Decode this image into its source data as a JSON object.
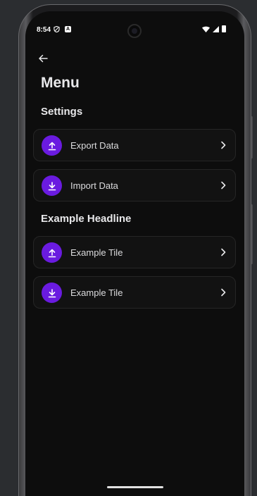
{
  "status_bar": {
    "time": "8:54",
    "icons": [
      "shield-icon",
      "a-icon",
      "wifi-icon",
      "signal-icon",
      "battery-icon"
    ]
  },
  "header": {
    "back_icon": "arrow-left-icon",
    "title": "Menu"
  },
  "sections": [
    {
      "title": "Settings",
      "tiles": [
        {
          "label": "Export Data",
          "icon": "upload-icon"
        },
        {
          "label": "Import Data",
          "icon": "download-icon"
        }
      ]
    },
    {
      "title": "Example Headline",
      "tiles": [
        {
          "label": "Example Tile",
          "icon": "upload-icon"
        },
        {
          "label": "Example Tile",
          "icon": "download-icon"
        }
      ]
    }
  ],
  "colors": {
    "accent": "#6a1be0",
    "background": "#0d0d0d",
    "tile_background": "#121212",
    "text": "#e8e8ea"
  }
}
